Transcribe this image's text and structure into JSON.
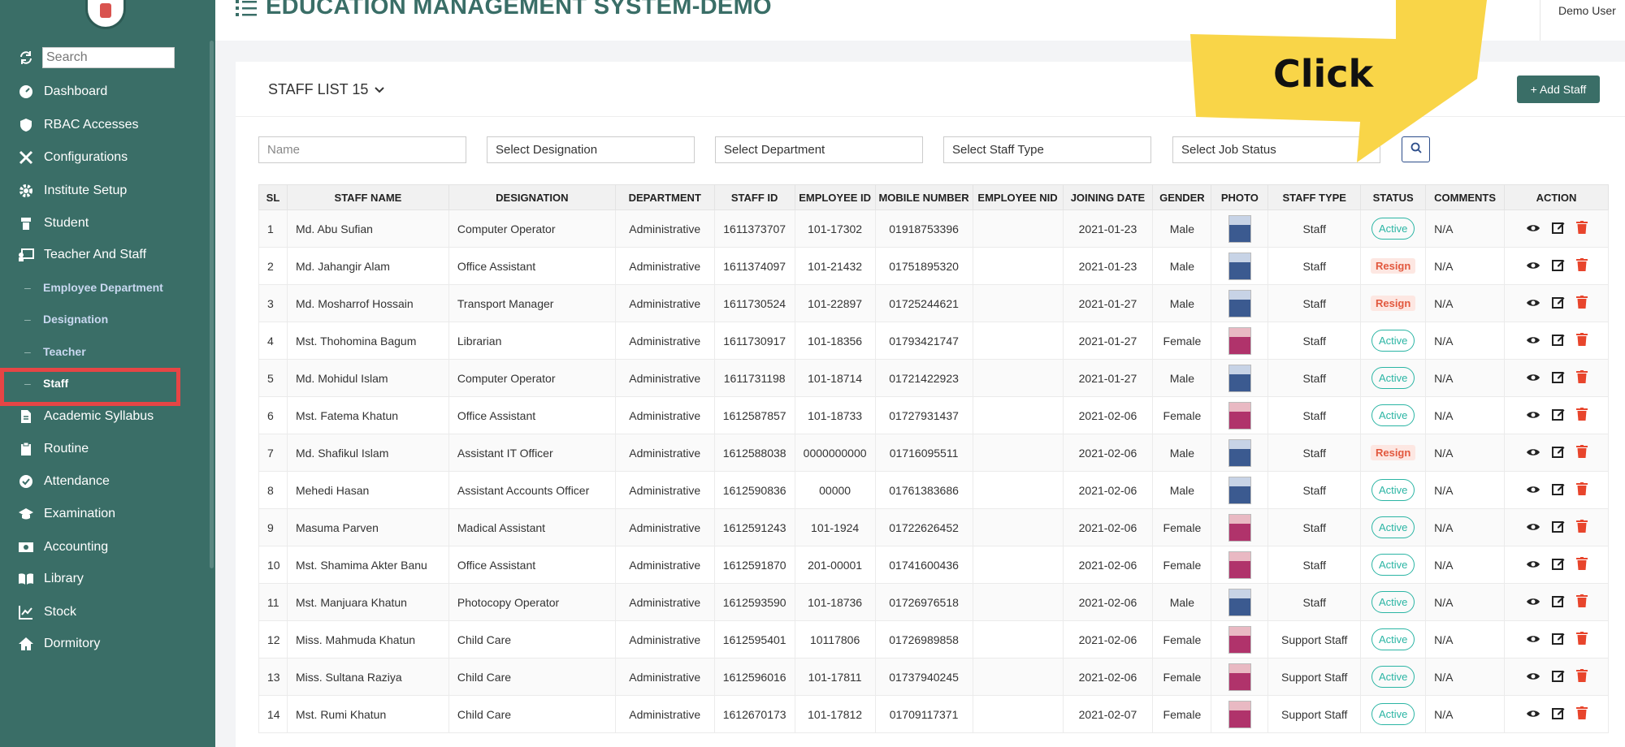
{
  "sidebar": {
    "search_placeholder": "Search",
    "items": [
      {
        "label": "Dashboard",
        "icon": "dashboard-icon"
      },
      {
        "label": "RBAC Accesses",
        "icon": "shield-icon"
      },
      {
        "label": "Configurations",
        "icon": "tools-icon"
      },
      {
        "label": "Institute Setup",
        "icon": "gear-icon"
      },
      {
        "label": "Student",
        "icon": "student-icon"
      },
      {
        "label": "Teacher And Staff",
        "icon": "teacher-icon"
      },
      {
        "label": "Academic Syllabus",
        "icon": "document-icon"
      },
      {
        "label": "Routine",
        "icon": "clipboard-icon"
      },
      {
        "label": "Attendance",
        "icon": "check-circle-icon"
      },
      {
        "label": "Examination",
        "icon": "graduation-cap-icon"
      },
      {
        "label": "Accounting",
        "icon": "money-icon"
      },
      {
        "label": "Library",
        "icon": "book-icon"
      },
      {
        "label": "Stock",
        "icon": "chart-line-icon"
      },
      {
        "label": "Dormitory",
        "icon": "home-icon"
      }
    ],
    "sub_items": [
      {
        "label": "Employee Department"
      },
      {
        "label": "Designation"
      },
      {
        "label": "Teacher"
      },
      {
        "label": "Staff"
      }
    ]
  },
  "header": {
    "title": "EDUCATION MANAGEMENT SYSTEM-DEMO",
    "user": "Demo User"
  },
  "card": {
    "list_title": "STAFF LIST 15",
    "add_button": "+ Add Staff"
  },
  "filters": {
    "name_placeholder": "Name",
    "designation": "Select Designation",
    "department": "Select Department",
    "staff_type": "Select Staff Type",
    "job_status": "Select Job Status"
  },
  "table": {
    "columns": [
      "SL",
      "STAFF NAME",
      "DESIGNATION",
      "DEPARTMENT",
      "STAFF ID",
      "EMPLOYEE ID",
      "MOBILE NUMBER",
      "EMPLOYEE NID",
      "JOINING DATE",
      "GENDER",
      "PHOTO",
      "STAFF TYPE",
      "STATUS",
      "COMMENTS",
      "ACTION"
    ],
    "rows": [
      {
        "sl": "1",
        "name": "Md. Abu Sufian",
        "designation": "Computer Operator",
        "department": "Administrative",
        "staff_id": "1611373707",
        "employee_id": "101-17302",
        "mobile": "01918753396",
        "nid": "",
        "joining": "2021-01-23",
        "gender": "Male",
        "type": "Staff",
        "status": "Active",
        "comments": "N/A"
      },
      {
        "sl": "2",
        "name": "Md. Jahangir Alam",
        "designation": "Office Assistant",
        "department": "Administrative",
        "staff_id": "1611374097",
        "employee_id": "101-21432",
        "mobile": "01751895320",
        "nid": "",
        "joining": "2021-01-23",
        "gender": "Male",
        "type": "Staff",
        "status": "Resign",
        "comments": "N/A"
      },
      {
        "sl": "3",
        "name": "Md. Mosharrof Hossain",
        "designation": "Transport Manager",
        "department": "Administrative",
        "staff_id": "1611730524",
        "employee_id": "101-22897",
        "mobile": "01725244621",
        "nid": "",
        "joining": "2021-01-27",
        "gender": "Male",
        "type": "Staff",
        "status": "Resign",
        "comments": "N/A"
      },
      {
        "sl": "4",
        "name": "Mst. Thohomina Bagum",
        "designation": "Librarian",
        "department": "Administrative",
        "staff_id": "1611730917",
        "employee_id": "101-18356",
        "mobile": "01793421747",
        "nid": "",
        "joining": "2021-01-27",
        "gender": "Female",
        "type": "Staff",
        "status": "Active",
        "comments": "N/A"
      },
      {
        "sl": "5",
        "name": "Md. Mohidul Islam",
        "designation": "Computer Operator",
        "department": "Administrative",
        "staff_id": "1611731198",
        "employee_id": "101-18714",
        "mobile": "01721422923",
        "nid": "",
        "joining": "2021-01-27",
        "gender": "Male",
        "type": "Staff",
        "status": "Active",
        "comments": "N/A"
      },
      {
        "sl": "6",
        "name": "Mst. Fatema Khatun",
        "designation": "Office Assistant",
        "department": "Administrative",
        "staff_id": "1612587857",
        "employee_id": "101-18733",
        "mobile": "01727931437",
        "nid": "",
        "joining": "2021-02-06",
        "gender": "Female",
        "type": "Staff",
        "status": "Active",
        "comments": "N/A"
      },
      {
        "sl": "7",
        "name": "Md. Shafikul Islam",
        "designation": "Assistant IT Officer",
        "department": "Administrative",
        "staff_id": "1612588038",
        "employee_id": "0000000000",
        "mobile": "01716095511",
        "nid": "",
        "joining": "2021-02-06",
        "gender": "Male",
        "type": "Staff",
        "status": "Resign",
        "comments": "N/A"
      },
      {
        "sl": "8",
        "name": "Mehedi Hasan",
        "designation": "Assistant Accounts Officer",
        "department": "Administrative",
        "staff_id": "1612590836",
        "employee_id": "00000",
        "mobile": "01761383686",
        "nid": "",
        "joining": "2021-02-06",
        "gender": "Male",
        "type": "Staff",
        "status": "Active",
        "comments": "N/A"
      },
      {
        "sl": "9",
        "name": "Masuma Parven",
        "designation": "Madical Assistant",
        "department": "Administrative",
        "staff_id": "1612591243",
        "employee_id": "101-1924",
        "mobile": "01722626452",
        "nid": "",
        "joining": "2021-02-06",
        "gender": "Female",
        "type": "Staff",
        "status": "Active",
        "comments": "N/A"
      },
      {
        "sl": "10",
        "name": "Mst. Shamima Akter Banu",
        "designation": "Office Assistant",
        "department": "Administrative",
        "staff_id": "1612591870",
        "employee_id": "201-00001",
        "mobile": "01741600436",
        "nid": "",
        "joining": "2021-02-06",
        "gender": "Female",
        "type": "Staff",
        "status": "Active",
        "comments": "N/A"
      },
      {
        "sl": "11",
        "name": "Mst. Manjuara Khatun",
        "designation": "Photocopy Operator",
        "department": "Administrative",
        "staff_id": "1612593590",
        "employee_id": "101-18736",
        "mobile": "01726976518",
        "nid": "",
        "joining": "2021-02-06",
        "gender": "Male",
        "type": "Staff",
        "status": "Active",
        "comments": "N/A"
      },
      {
        "sl": "12",
        "name": "Miss. Mahmuda Khatun",
        "designation": "Child Care",
        "department": "Administrative",
        "staff_id": "1612595401",
        "employee_id": "10117806",
        "mobile": "01726989858",
        "nid": "",
        "joining": "2021-02-06",
        "gender": "Female",
        "type": "Support Staff",
        "status": "Active",
        "comments": "N/A"
      },
      {
        "sl": "13",
        "name": "Miss. Sultana Raziya",
        "designation": "Child Care",
        "department": "Administrative",
        "staff_id": "1612596016",
        "employee_id": "101-17811",
        "mobile": "01737940245",
        "nid": "",
        "joining": "2021-02-06",
        "gender": "Female",
        "type": "Support Staff",
        "status": "Active",
        "comments": "N/A"
      },
      {
        "sl": "14",
        "name": "Mst. Rumi Khatun",
        "designation": "Child Care",
        "department": "Administrative",
        "staff_id": "1612670173",
        "employee_id": "101-17812",
        "mobile": "01709117371",
        "nid": "",
        "joining": "2021-02-07",
        "gender": "Female",
        "type": "Support Staff",
        "status": "Active",
        "comments": "N/A"
      }
    ]
  },
  "callout": {
    "text": "Click",
    "color": "#f9d548"
  },
  "colors": {
    "sidebar_bg": "#3a6e67",
    "accent": "#3a6e67",
    "active_status": "#2bb5a4",
    "resign_status": "#e2583e",
    "highlight_box": "#e64545"
  }
}
